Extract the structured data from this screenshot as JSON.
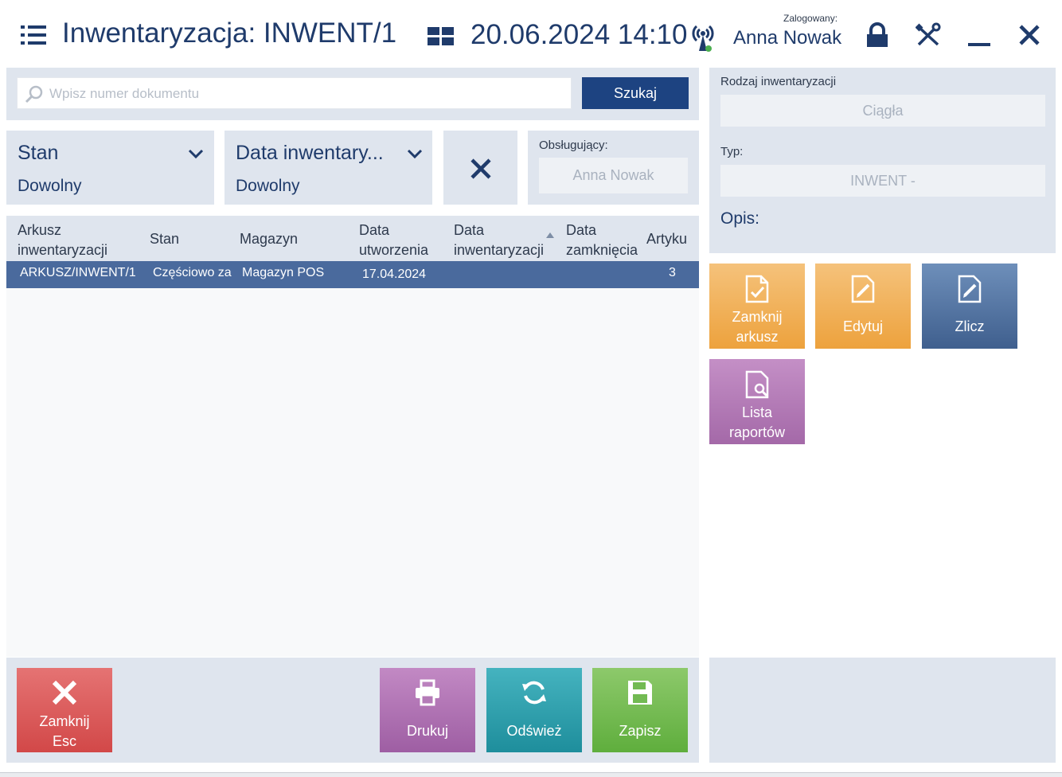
{
  "header": {
    "title": "Inwentaryzacja: INWENT/1",
    "datetime": "20.06.2024 14:10",
    "logged_label": "Zalogowany:",
    "logged_user": "Anna Nowak",
    "icons": [
      "menu-icon",
      "grid-icon",
      "connection-antenna-icon",
      "lock-icon",
      "tools-icon",
      "minimize-icon",
      "close-icon"
    ]
  },
  "search": {
    "placeholder": "Wpisz numer dokumentu",
    "value": "",
    "button_label": "Szukaj"
  },
  "filters": {
    "stan": {
      "title": "Stan",
      "value": "Dowolny"
    },
    "data": {
      "title": "Data inwentary...",
      "value": "Dowolny"
    },
    "operator": {
      "label": "Obsługujący:",
      "value": "Anna Nowak"
    }
  },
  "table": {
    "columns": [
      {
        "line1": "Arkusz",
        "line2": "inwentaryzacji"
      },
      {
        "line1": "Stan",
        "line2": ""
      },
      {
        "line1": "Magazyn",
        "line2": ""
      },
      {
        "line1": "Data",
        "line2": "utworzenia"
      },
      {
        "line1": "Data",
        "line2": "inwentaryzacji"
      },
      {
        "line1": "Data",
        "line2": "zamknięcia"
      },
      {
        "line1": "Artyku",
        "line2": ""
      }
    ],
    "rows": [
      [
        "ARKUSZ/INWENT/1",
        "Częściowo za",
        "Magazyn POS",
        "17.04.2024",
        "",
        "",
        "3"
      ]
    ],
    "sorted_column": "Data inwentaryzacji"
  },
  "side": {
    "rodzaj_label": "Rodzaj inwentaryzacji",
    "rodzaj_value": "Ciągła",
    "typ_label": "Typ:",
    "typ_value": "INWENT -",
    "opis_label": "Opis:"
  },
  "actions": {
    "zamknij_arkusz": {
      "line1": "Zamknij",
      "line2": "arkusz"
    },
    "edytuj": "Edytuj",
    "zlicz": "Zlicz",
    "lista_raportow": {
      "line1": "Lista",
      "line2": "raportów"
    }
  },
  "bottom": {
    "close": {
      "line1": "Zamknij",
      "line2": "Esc"
    },
    "print": "Drukuj",
    "refresh": "Odśwież",
    "save": "Zapisz"
  },
  "colors": {
    "accent": "#1d4381",
    "selected_row": "#4a6a9d",
    "panel": "#dfe5ee",
    "orange": "#eda23d",
    "purple": "#a469a8",
    "red": "#d24848",
    "teal": "#1e8e9c",
    "green": "#5fae3d"
  }
}
